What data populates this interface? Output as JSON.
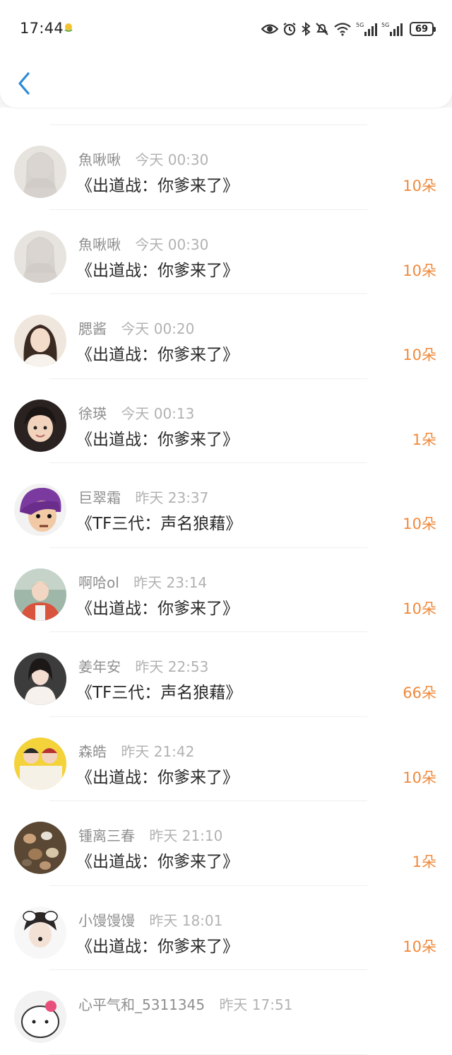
{
  "status_bar": {
    "time": "17:44",
    "battery": "69",
    "signal_label_1": "5G",
    "signal_label_2": "5G"
  },
  "header": {
    "back_icon": "chevron-left-icon",
    "accent_color": "#2e8bd8"
  },
  "amount_color": "#f08a3c",
  "gifts": [
    {
      "name": "魚啾啾",
      "time": "今天 00:30",
      "title": "《出道战：你爹来了》",
      "amount": "10朵"
    },
    {
      "name": "魚啾啾",
      "time": "今天 00:30",
      "title": "《出道战：你爹来了》",
      "amount": "10朵"
    },
    {
      "name": "腮酱",
      "time": "今天 00:20",
      "title": "《出道战：你爹来了》",
      "amount": "10朵"
    },
    {
      "name": "徐瑛",
      "time": "今天 00:13",
      "title": "《出道战：你爹来了》",
      "amount": "1朵"
    },
    {
      "name": "巨翠霜",
      "time": "昨天 23:37",
      "title": "《TF三代：声名狼藉》",
      "amount": "10朵"
    },
    {
      "name": "啊哈ol",
      "time": "昨天 23:14",
      "title": "《出道战：你爹来了》",
      "amount": "10朵"
    },
    {
      "name": "姜年安",
      "time": "昨天 22:53",
      "title": "《TF三代：声名狼藉》",
      "amount": "66朵"
    },
    {
      "name": "森皓",
      "time": "昨天 21:42",
      "title": "《出道战：你爹来了》",
      "amount": "10朵"
    },
    {
      "name": "锺离三春",
      "time": "昨天 21:10",
      "title": "《出道战：你爹来了》",
      "amount": "1朵"
    },
    {
      "name": "小馒馒馒",
      "time": "昨天 18:01",
      "title": "《出道战：你爹来了》",
      "amount": "10朵"
    },
    {
      "name": "心平气和_5311345",
      "time": "昨天 17:51",
      "title": "",
      "amount": ""
    }
  ]
}
